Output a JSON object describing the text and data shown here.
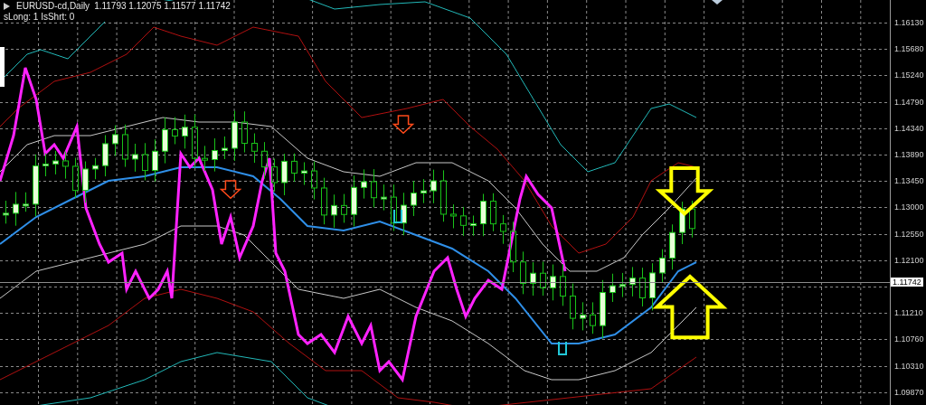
{
  "chart_header": {
    "symbol": "EURUSD-cd,Daily",
    "prices": [
      "1.11793",
      "1.12075",
      "1.11577",
      "1.11742"
    ]
  },
  "indicator_info": "sLong: 1 IsShrt: 0",
  "price_axis": {
    "ticks_above": [
      "1.16130",
      "1.15680",
      "1.15240",
      "1.14790",
      "1.14340",
      "1.13890",
      "1.13450",
      "1.13000",
      "1.12550",
      "1.12100"
    ],
    "ticks_below": [
      "1.11210",
      "1.10760",
      "1.10310",
      "1.09870"
    ],
    "current_price": "1.11742"
  }
}
